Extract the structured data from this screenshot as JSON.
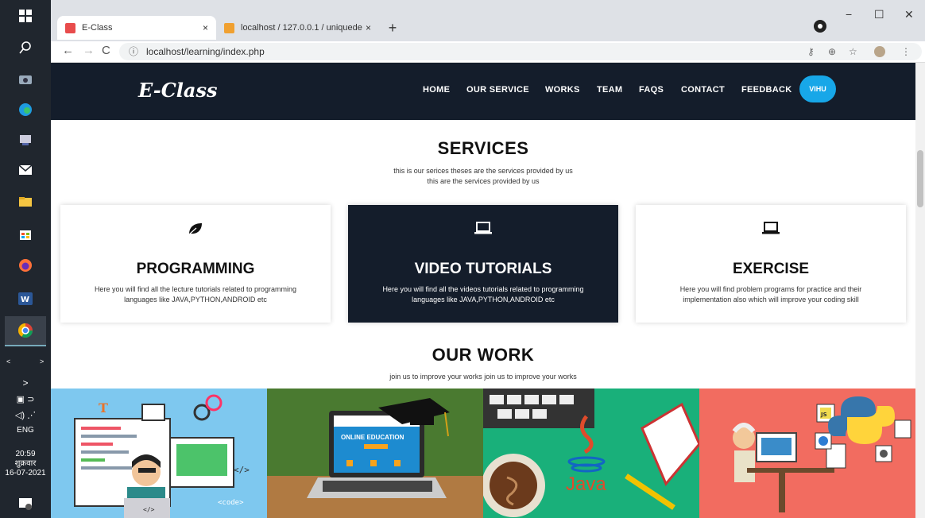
{
  "taskbar": {
    "lang": "ENG",
    "time": "20:59",
    "day": "शुक्रवार",
    "date": "16-07-2021"
  },
  "browser": {
    "tabs": [
      {
        "title": "E-Class",
        "close": "×"
      },
      {
        "title": "localhost / 127.0.0.1 / uniquede",
        "close": "×"
      }
    ],
    "new_tab": "+",
    "url": "localhost/learning/index.php",
    "window": {
      "minimize": "−",
      "maximize": "☐",
      "close": "✕"
    }
  },
  "site": {
    "logo": "E-Class",
    "nav": [
      "HOME",
      "OUR SERVICE",
      "WORKS",
      "TEAM",
      "FAQS",
      "CONTACT",
      "FEEDBACK"
    ],
    "user_pill": "VIHU"
  },
  "services": {
    "title": "SERVICES",
    "subtitle_line1": "this is our serices theses are the services provided by us",
    "subtitle_line2": "this are the services provided by us",
    "cards": [
      {
        "icon": "leaf-icon",
        "title": "PROGRAMMING",
        "desc": "Here you will find all the lecture tutorials related to programming languages like JAVA,PYTHON,ANDROID etc"
      },
      {
        "icon": "laptop-icon",
        "title": "VIDEO TUTORIALS",
        "desc": "Here you will find all the videos tutorials related to programming languages like JAVA,PYTHON,ANDROID etc"
      },
      {
        "icon": "laptop-icon",
        "title": "EXERCISE",
        "desc": "Here you will find problem programs for practice and their implementation also which will improve your coding skill"
      }
    ]
  },
  "work": {
    "title": "OUR WORK",
    "subtitle": "join us to improve your works join us to improve your works",
    "panel_texts": {
      "online_education": "ONLINE EDUCATION",
      "java": "Java",
      "code_tag": "</>",
      "code_word": "<code>",
      "js": "JS"
    }
  },
  "colors": {
    "nav_bg": "#141d2b",
    "pill": "#17a7e8",
    "panel1": "#7ec8ef",
    "panel2": "#3f6d2a",
    "panel3": "#19b07a",
    "panel4": "#f26c60"
  }
}
